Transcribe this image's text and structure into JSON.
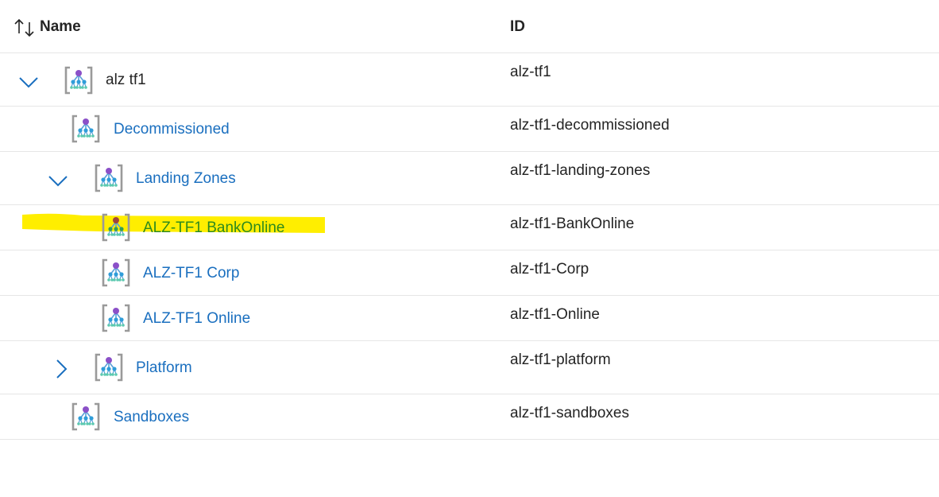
{
  "header": {
    "name_label": "Name",
    "id_label": "ID"
  },
  "rows": [
    {
      "name": "alz tf1",
      "id": "alz-tf1",
      "expander": "chevron-down"
    },
    {
      "name": "Decommissioned",
      "id": "alz-tf1-decommissioned",
      "expander": "none"
    },
    {
      "name": "Landing Zones",
      "id": "alz-tf1-landing-zones",
      "expander": "chevron-down"
    },
    {
      "name": "ALZ-TF1 BankOnline",
      "id": "alz-tf1-BankOnline",
      "expander": "none",
      "highlighted": true
    },
    {
      "name": "ALZ-TF1 Corp",
      "id": "alz-tf1-Corp",
      "expander": "none"
    },
    {
      "name": "ALZ-TF1 Online",
      "id": "alz-tf1-Online",
      "expander": "none"
    },
    {
      "name": "Platform",
      "id": "alz-tf1-platform",
      "expander": "chevron-right"
    },
    {
      "name": "Sandboxes",
      "id": "alz-tf1-sandboxes",
      "expander": "none"
    }
  ],
  "icons": {
    "row_icon": "management-group-icon",
    "sort_icon": "sort-arrows-icon"
  },
  "colors": {
    "link": "#1a6fbf",
    "highlight": "#ffee00",
    "highlighted_text": "#2e8b1e",
    "divider": "#e6e6e6"
  }
}
